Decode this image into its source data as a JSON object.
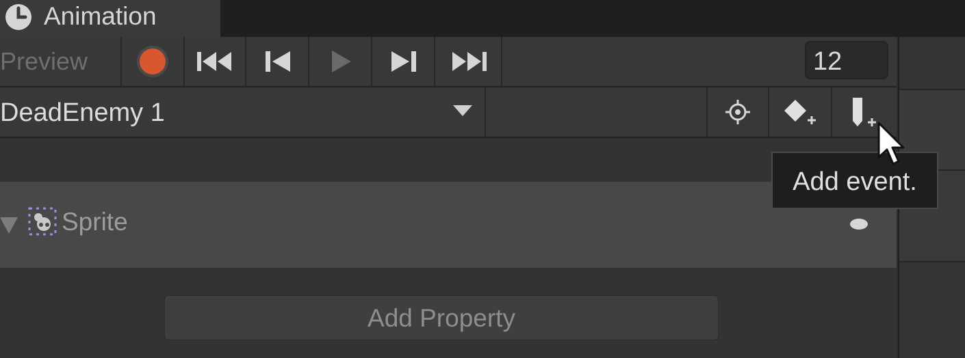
{
  "window": {
    "tab_title": "Animation",
    "tab_icon": "clock-icon"
  },
  "toolbar": {
    "preview_label": "Preview",
    "buttons": [
      {
        "icon": "record-icon",
        "label": "Record"
      },
      {
        "icon": "first-key-icon",
        "label": "Go to beginning"
      },
      {
        "icon": "prev-key-icon",
        "label": "Previous keyframe"
      },
      {
        "icon": "play-icon",
        "label": "Play"
      },
      {
        "icon": "next-key-icon",
        "label": "Next keyframe"
      },
      {
        "icon": "last-key-icon",
        "label": "Go to end"
      }
    ],
    "frame_value": "12"
  },
  "clip_bar": {
    "clip_name": "DeadEnemy 1",
    "buttons": [
      {
        "icon": "crosshair-icon"
      },
      {
        "icon": "add-keyframe-icon"
      },
      {
        "icon": "add-event-icon"
      }
    ]
  },
  "tooltip": {
    "text": "Add event."
  },
  "properties": {
    "items": [
      {
        "label": "Sprite",
        "icon": "sprite-renderer-icon"
      }
    ],
    "add_property_label": "Add Property"
  },
  "colors": {
    "record": "#d9572e",
    "background": "#383838",
    "property_row": "#484848"
  }
}
